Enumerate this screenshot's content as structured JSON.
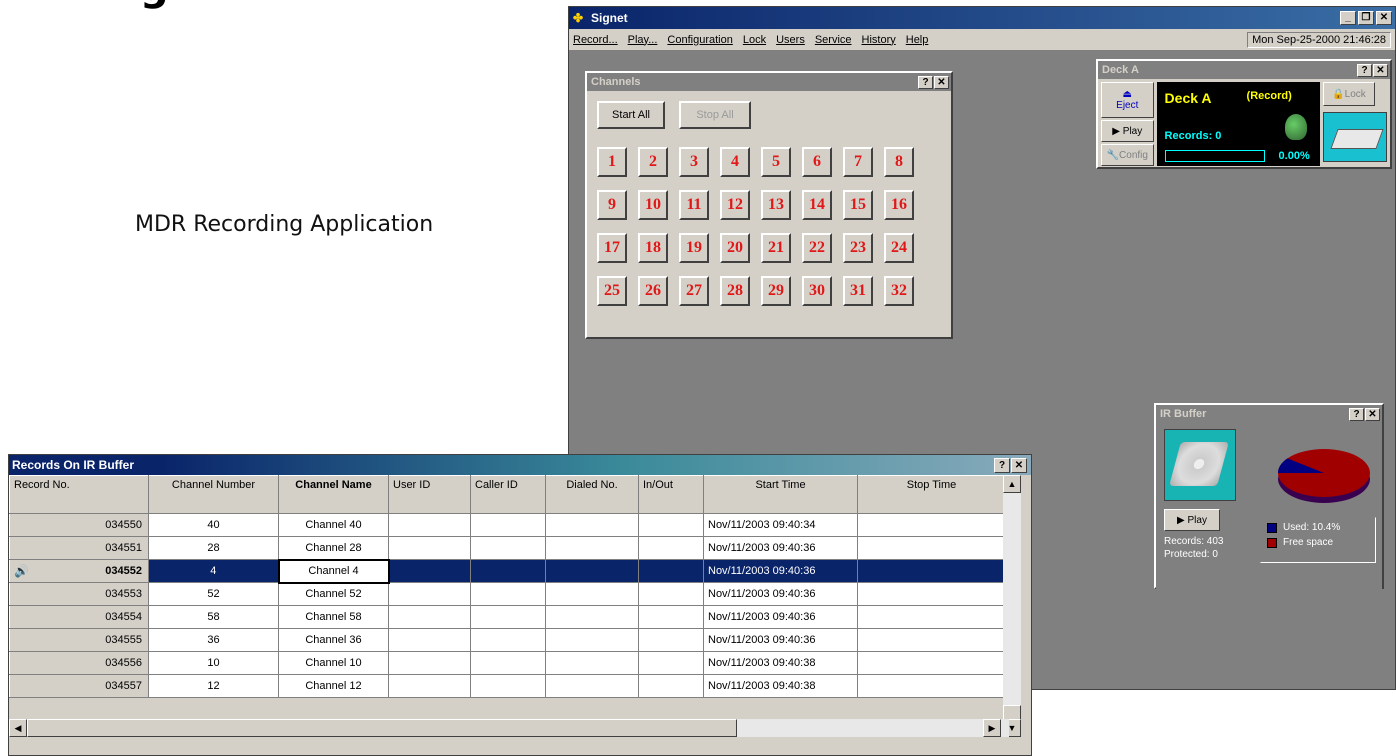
{
  "slide": {
    "title_fragment": "g",
    "label": "MDR Recording Application"
  },
  "app": {
    "title": "Signet",
    "menu": [
      "Record...",
      "Play...",
      "Configuration",
      "Lock",
      "Users",
      "Service",
      "History",
      "Help"
    ],
    "clock": "Mon Sep-25-2000  21:46:28"
  },
  "channels_panel": {
    "title": "Channels",
    "start_all": "Start All",
    "stop_all": "Stop All",
    "channels": [
      "1",
      "2",
      "3",
      "4",
      "5",
      "6",
      "7",
      "8",
      "9",
      "10",
      "11",
      "12",
      "13",
      "14",
      "15",
      "16",
      "17",
      "18",
      "19",
      "20",
      "21",
      "22",
      "23",
      "24",
      "25",
      "26",
      "27",
      "28",
      "29",
      "30",
      "31",
      "32"
    ]
  },
  "deck_panel": {
    "title": "Deck A",
    "eject": "Eject",
    "play": "Play",
    "config": "Config",
    "lock": "Lock",
    "deck_name": "Deck A",
    "status": "(Record)",
    "records": "Records: 0",
    "percent": "0.00%",
    "progress": 0
  },
  "ir_buffer": {
    "title": "IR Buffer",
    "play": "Play",
    "records": "Records: 403",
    "protected": "Protected: 0",
    "used_label": "Used:  10.4%",
    "free_label": "Free space",
    "used_fraction": 0.104,
    "used_color": "#000080",
    "free_color": "#a00000"
  },
  "records_window": {
    "title": "Records On IR Buffer",
    "columns": [
      "Record No.",
      "Channel Number",
      "Channel Name",
      "User ID",
      "Caller ID",
      "Dialed No.",
      "In/Out",
      "Start Time",
      "Stop Time"
    ],
    "rows": [
      {
        "rec": "034550",
        "ch": "40",
        "name": "Channel 40",
        "start": "Nov/11/2003 09:40:34"
      },
      {
        "rec": "034551",
        "ch": "28",
        "name": "Channel 28",
        "start": "Nov/11/2003 09:40:36"
      },
      {
        "rec": "034552",
        "ch": "4",
        "name": "Channel 4",
        "start": "Nov/11/2003 09:40:36"
      },
      {
        "rec": "034553",
        "ch": "52",
        "name": "Channel 52",
        "start": "Nov/11/2003 09:40:36"
      },
      {
        "rec": "034554",
        "ch": "58",
        "name": "Channel 58",
        "start": "Nov/11/2003 09:40:36"
      },
      {
        "rec": "034555",
        "ch": "36",
        "name": "Channel 36",
        "start": "Nov/11/2003 09:40:36"
      },
      {
        "rec": "034556",
        "ch": "10",
        "name": "Channel 10",
        "start": "Nov/11/2003 09:40:38"
      },
      {
        "rec": "034557",
        "ch": "12",
        "name": "Channel 12",
        "start": "Nov/11/2003 09:40:38"
      }
    ]
  }
}
